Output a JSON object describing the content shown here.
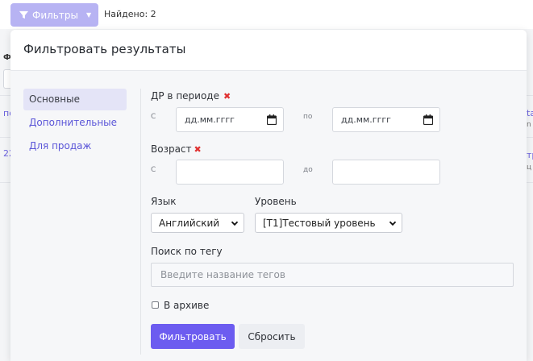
{
  "toolbar": {
    "filter_button": "Фильтры",
    "found_text": "Найдено: 2"
  },
  "background": {
    "frag_ph": "Ф",
    "frag_po": "по",
    "frag_22": "22",
    "frag_ta": "ta",
    "frag_n": "n",
    "frag_tr": "тр",
    "frag_ts": "ц"
  },
  "popup": {
    "title": "Фильтровать результаты"
  },
  "sidebar": {
    "items": [
      {
        "label": "Основные",
        "active": true
      },
      {
        "label": "Дополнительные",
        "active": false
      },
      {
        "label": "Для продаж",
        "active": false
      }
    ]
  },
  "filters": {
    "birthday": {
      "label": "ДР в периоде",
      "from_label": "С",
      "to_label": "по",
      "from_placeholder": "дд.мм.гггг",
      "to_placeholder": "дд.мм.гггг"
    },
    "age": {
      "label": "Возраст",
      "from_label": "С",
      "to_label": "до",
      "from_value": "",
      "to_value": ""
    },
    "language": {
      "label": "Язык",
      "selected": "Английский"
    },
    "level": {
      "label": "Уровень",
      "selected": "[T1]Тестовый уровень"
    },
    "tag_search": {
      "label": "Поиск по тегу",
      "placeholder": "Введите название тегов"
    },
    "archive": {
      "label": "В архиве",
      "checked": false
    }
  },
  "actions": {
    "apply": "Фильтровать",
    "reset": "Сбросить"
  },
  "colors": {
    "accent": "#6c5cf0",
    "filter_button": "#b7b3f3",
    "link": "#5b56d8",
    "clear_mark": "#e03131"
  }
}
